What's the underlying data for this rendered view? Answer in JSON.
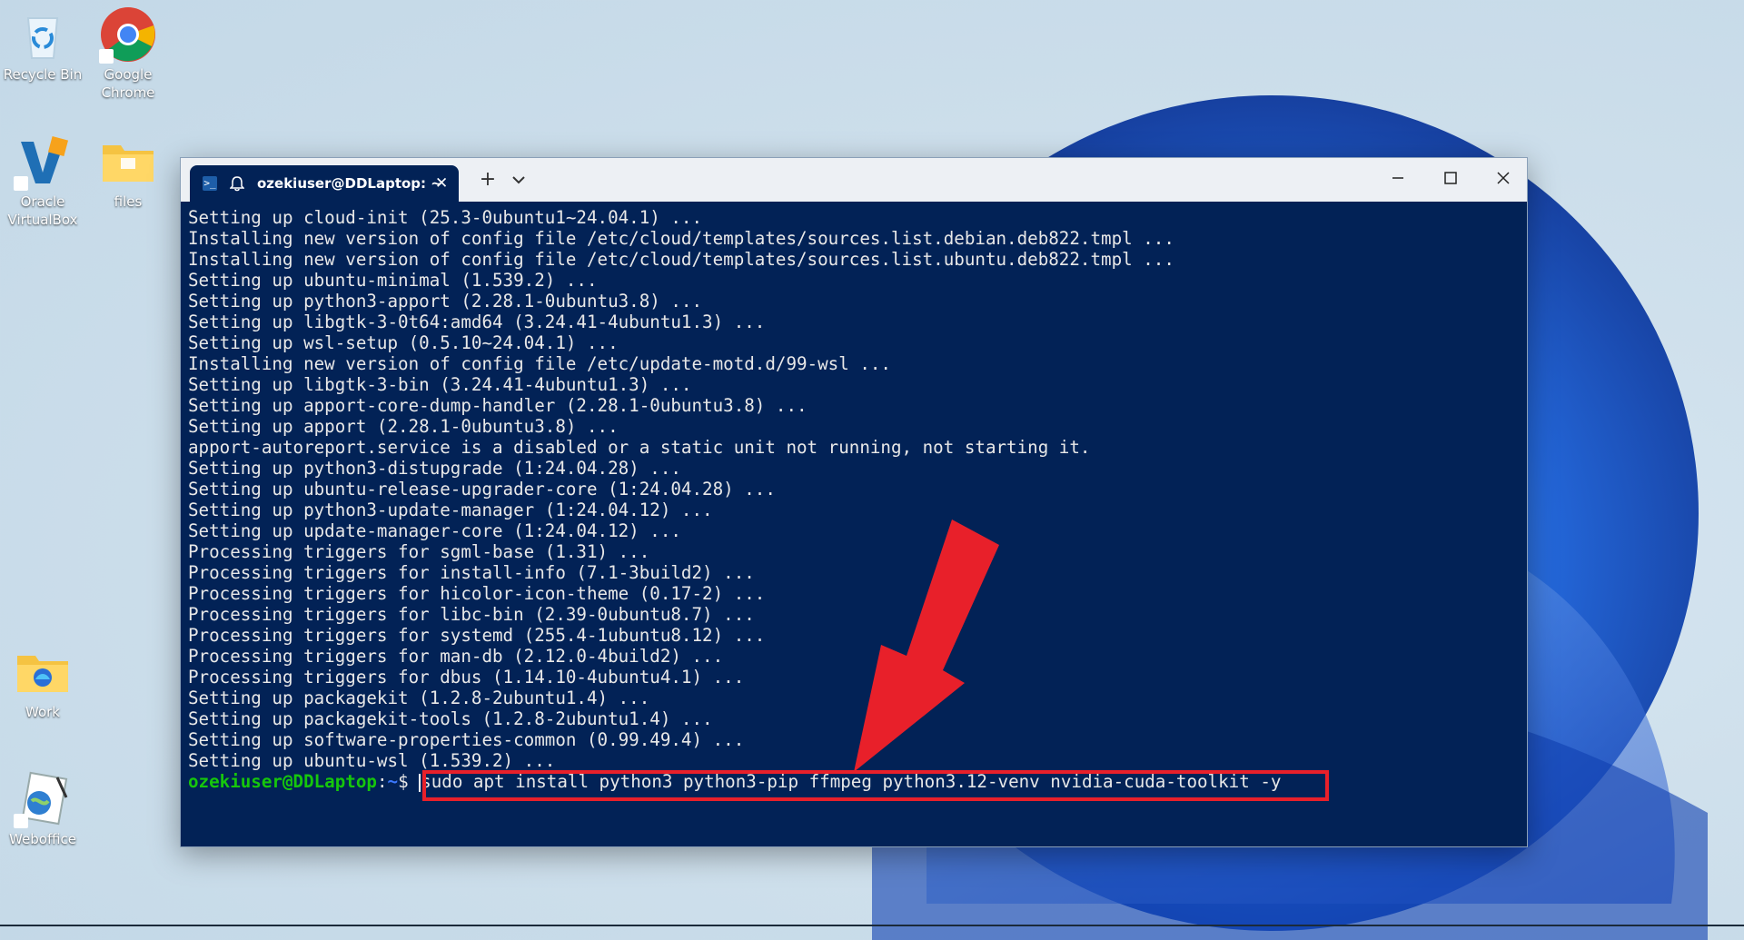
{
  "desktop": {
    "icons": [
      {
        "label": "Recycle Bin"
      },
      {
        "label": "Google Chrome"
      },
      {
        "label": "Oracle VirtualBox"
      },
      {
        "label": "files"
      },
      {
        "label": "Work"
      },
      {
        "label": "Weboffice"
      }
    ]
  },
  "terminal": {
    "tab_title": "ozekiuser@DDLaptop: ~",
    "tab_icon": "powershell-icon",
    "output_lines": [
      "Setting up cloud-init (25.3-0ubuntu1~24.04.1) ...",
      "Installing new version of config file /etc/cloud/templates/sources.list.debian.deb822.tmpl ...",
      "Installing new version of config file /etc/cloud/templates/sources.list.ubuntu.deb822.tmpl ...",
      "Setting up ubuntu-minimal (1.539.2) ...",
      "Setting up python3-apport (2.28.1-0ubuntu3.8) ...",
      "Setting up libgtk-3-0t64:amd64 (3.24.41-4ubuntu1.3) ...",
      "Setting up wsl-setup (0.5.10~24.04.1) ...",
      "Installing new version of config file /etc/update-motd.d/99-wsl ...",
      "Setting up libgtk-3-bin (3.24.41-4ubuntu1.3) ...",
      "Setting up apport-core-dump-handler (2.28.1-0ubuntu3.8) ...",
      "Setting up apport (2.28.1-0ubuntu3.8) ...",
      "apport-autoreport.service is a disabled or a static unit not running, not starting it.",
      "Setting up python3-distupgrade (1:24.04.28) ...",
      "Setting up ubuntu-release-upgrader-core (1:24.04.28) ...",
      "Setting up python3-update-manager (1:24.04.12) ...",
      "Setting up update-manager-core (1:24.04.12) ...",
      "Processing triggers for sgml-base (1.31) ...",
      "Processing triggers for install-info (7.1-3build2) ...",
      "Processing triggers for hicolor-icon-theme (0.17-2) ...",
      "Processing triggers for libc-bin (2.39-0ubuntu8.7) ...",
      "Processing triggers for systemd (255.4-1ubuntu8.12) ...",
      "Processing triggers for man-db (2.12.0-4build2) ...",
      "Processing triggers for dbus (1.14.10-4ubuntu4.1) ...",
      "Setting up packagekit (1.2.8-2ubuntu1.4) ...",
      "Setting up packagekit-tools (1.2.8-2ubuntu1.4) ...",
      "Setting up software-properties-common (0.99.49.4) ...",
      "Setting up ubuntu-wsl (1.539.2) ..."
    ],
    "prompt": {
      "user_host": "ozekiuser@DDLaptop",
      "path": "~",
      "symbol": "$ "
    },
    "command": "sudo apt install python3 python3-pip ffmpeg python3.12-venv nvidia-cuda-toolkit -y"
  },
  "colors": {
    "terminal_bg": "#022256",
    "highlight": "#e8202a",
    "prompt_user": "#16c60c",
    "prompt_path": "#3b78ff"
  }
}
